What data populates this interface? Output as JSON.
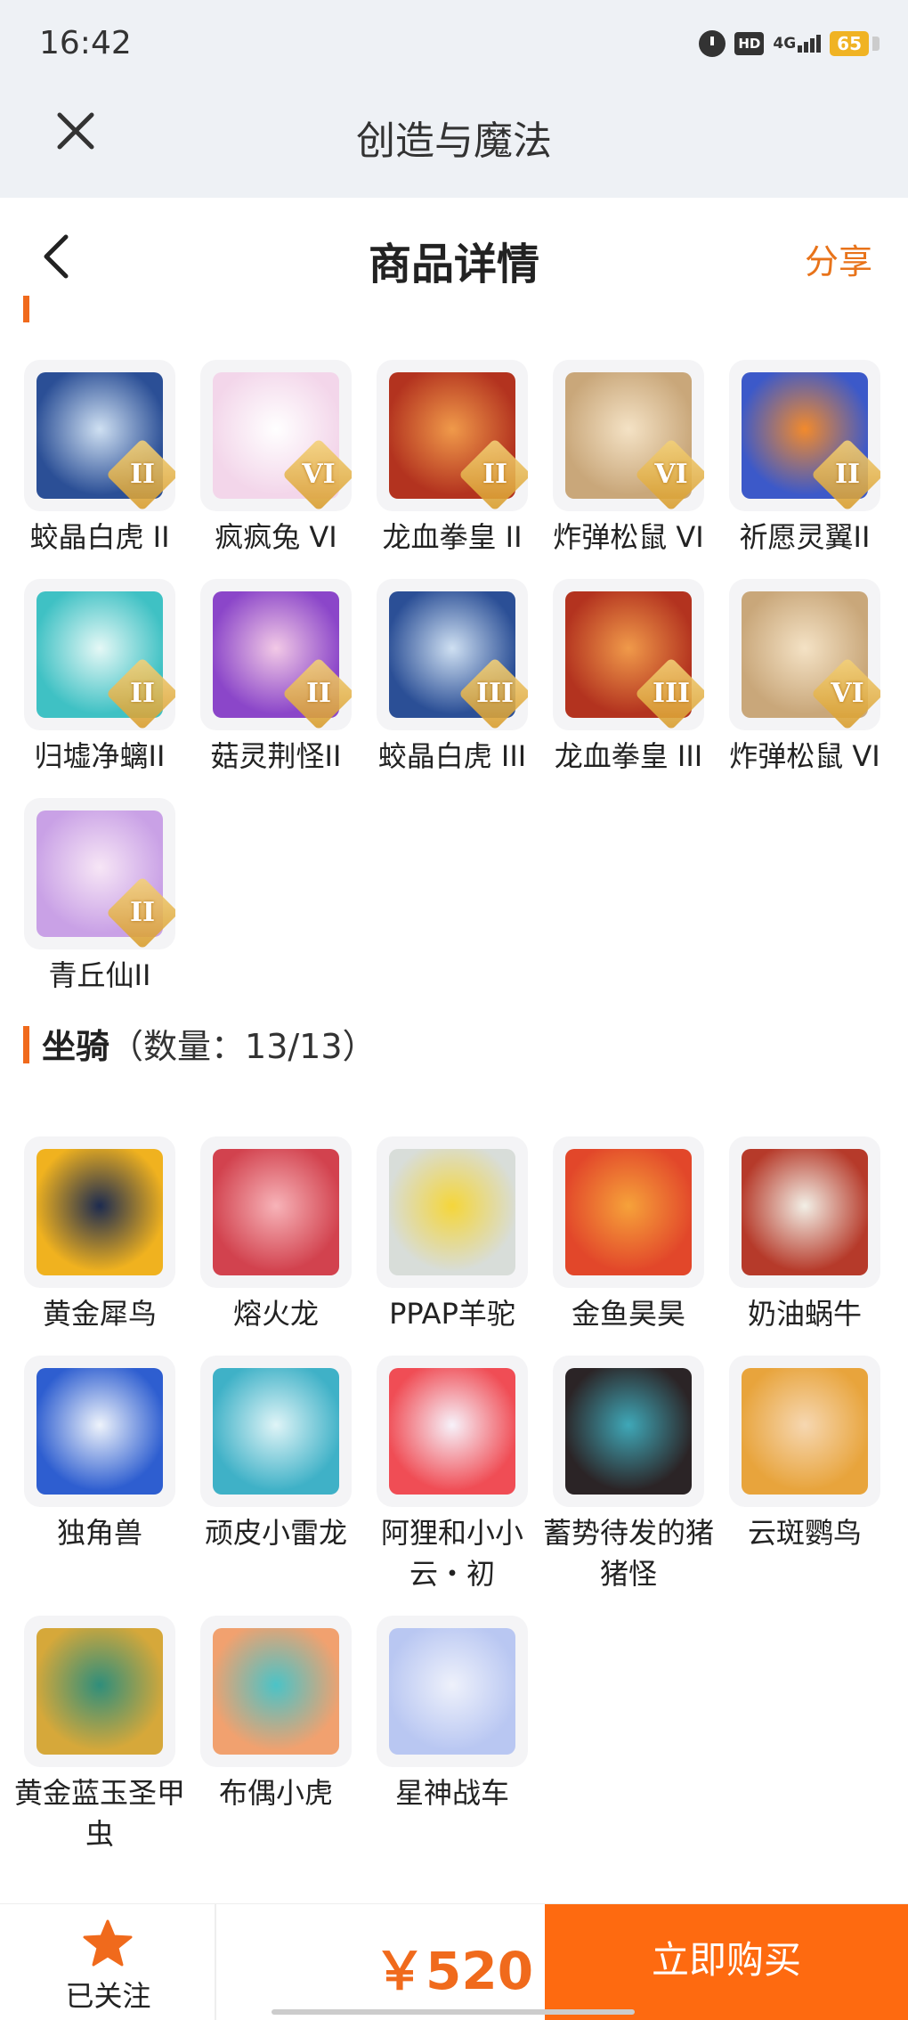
{
  "status_bar": {
    "time": "16:42",
    "hd": "HD",
    "network": "4G",
    "battery": "65"
  },
  "app_bar": {
    "title": "创造与魔法"
  },
  "page_header": {
    "title": "商品详情",
    "share_label": "分享"
  },
  "pets_section": {
    "items": [
      {
        "name": "蛟晶白虎 II",
        "tier": "II",
        "palette": [
          "#2b4f96",
          "#cfe0f2"
        ]
      },
      {
        "name": "疯疯兔 VI",
        "tier": "VI",
        "palette": [
          "#f3d6ea",
          "#ffffff"
        ]
      },
      {
        "name": "龙血拳皇 II",
        "tier": "II",
        "palette": [
          "#b3331f",
          "#f09a4a"
        ]
      },
      {
        "name": "炸弹松鼠 VI",
        "tier": "VI",
        "palette": [
          "#c9a77a",
          "#f4e2c5"
        ]
      },
      {
        "name": "祈愿灵翼II",
        "tier": "II",
        "palette": [
          "#3c59c9",
          "#f28a2c"
        ]
      },
      {
        "name": "归墟净螭II",
        "tier": "II",
        "palette": [
          "#3fc1c4",
          "#e5f8f6"
        ]
      },
      {
        "name": "菇灵荆怪II",
        "tier": "II",
        "palette": [
          "#8b46c9",
          "#f2c9e6"
        ]
      },
      {
        "name": "蛟晶白虎 III",
        "tier": "III",
        "palette": [
          "#2b4f96",
          "#cfe0f2"
        ]
      },
      {
        "name": "龙血拳皇 III",
        "tier": "III",
        "palette": [
          "#b3331f",
          "#f09a4a"
        ]
      },
      {
        "name": "炸弹松鼠 VI",
        "tier": "VI",
        "palette": [
          "#c9a77a",
          "#f4e2c5"
        ]
      },
      {
        "name": "青丘仙II",
        "tier": "II",
        "palette": [
          "#c9a1e6",
          "#f7e6f6"
        ]
      }
    ]
  },
  "mounts_section": {
    "title": "坐骑",
    "count": "（数量：13/13）",
    "items": [
      {
        "name": "黄金犀鸟",
        "palette": [
          "#f0b21f",
          "#1d2b4f"
        ]
      },
      {
        "name": "熔火龙",
        "palette": [
          "#d2424e",
          "#f7b3b8"
        ]
      },
      {
        "name": "PPAP羊驼",
        "palette": [
          "#d8ddd9",
          "#f5d63a"
        ]
      },
      {
        "name": "金鱼昊昊",
        "palette": [
          "#e2472a",
          "#f6a23a"
        ]
      },
      {
        "name": "奶油蜗牛",
        "palette": [
          "#b63a2a",
          "#f2efe6"
        ]
      },
      {
        "name": "独角兽",
        "palette": [
          "#2e5ed0",
          "#eef3fb"
        ]
      },
      {
        "name": "顽皮小雷龙",
        "palette": [
          "#3fb1c7",
          "#dff4f7"
        ]
      },
      {
        "name": "阿狸和小小云・初",
        "palette": [
          "#f04d55",
          "#f7f2fa"
        ]
      },
      {
        "name": "蓄势待发的猪猪怪",
        "palette": [
          "#2b2426",
          "#3fa8b8"
        ]
      },
      {
        "name": "云斑鹦鸟",
        "palette": [
          "#e8a43c",
          "#f6d7b1"
        ]
      },
      {
        "name": "黄金蓝玉圣甲虫",
        "palette": [
          "#d6a83a",
          "#2f8e7b"
        ]
      },
      {
        "name": "布偶小虎",
        "palette": [
          "#f1a16f",
          "#4bc3c7"
        ]
      },
      {
        "name": "星神战车",
        "palette": [
          "#b9c7f2",
          "#eef1fb"
        ]
      }
    ]
  },
  "bottom_bar": {
    "follow_label": "已关注",
    "price": "￥520",
    "buy_label": "立即购买"
  },
  "colors": {
    "accent": "#fe6a10",
    "price": "#f06a1c",
    "share": "#e8731a"
  }
}
